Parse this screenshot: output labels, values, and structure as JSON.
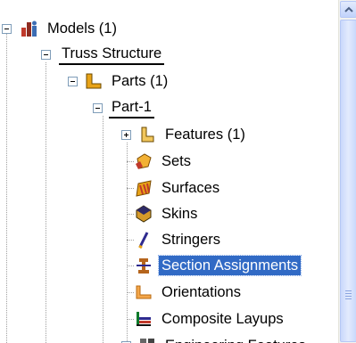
{
  "tree": {
    "models": "Models (1)",
    "truss": "Truss Structure",
    "parts": "Parts (1)",
    "part1": "Part-1",
    "features": "Features (1)",
    "sets": "Sets",
    "surfaces": "Surfaces",
    "skins": "Skins",
    "stringers": "Stringers",
    "section_assignments": "Section Assignments",
    "orientations": "Orientations",
    "composite_layups": "Composite Layups",
    "engineering_features": "Engineering Features"
  },
  "selected_item": "Section Assignments",
  "colors": {
    "selection": "#316ac5",
    "scroll_accent": "#c9d8fc"
  },
  "icons": [
    "models-icon",
    "parts-icon",
    "features-icon",
    "sets-icon",
    "surfaces-icon",
    "skins-icon",
    "stringers-icon",
    "section-assignments-icon",
    "orientations-icon",
    "composite-layups-icon",
    "engineering-features-icon"
  ]
}
